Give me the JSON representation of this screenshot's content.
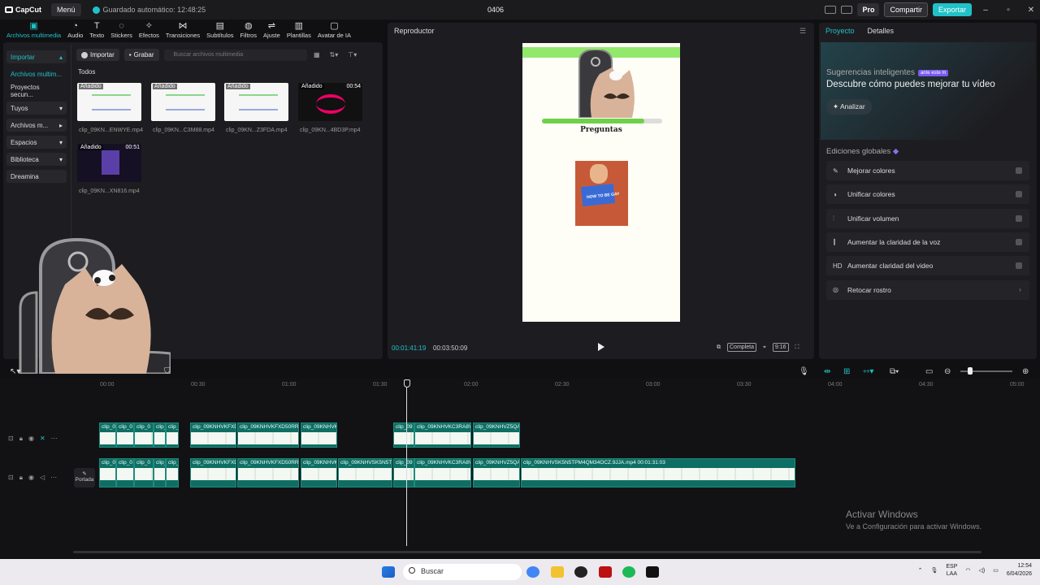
{
  "app": {
    "name": "CapCut",
    "menu_label": "Menú",
    "autosave": "Guardado automático: 12:48:25",
    "project_title": "0406"
  },
  "titlebar": {
    "pro_label": "Pro",
    "share_label": "Compartir",
    "export_label": "Exportar"
  },
  "tools": [
    {
      "label": "Archivos multimedia",
      "icon": "media-icon",
      "glyph": "▣"
    },
    {
      "label": "Audio",
      "icon": "audio-icon",
      "glyph": "◔"
    },
    {
      "label": "Texto",
      "icon": "text-icon",
      "glyph": "T"
    },
    {
      "label": "Stickers",
      "icon": "sticker-icon",
      "glyph": "◌"
    },
    {
      "label": "Efectos",
      "icon": "effects-icon",
      "glyph": "✧"
    },
    {
      "label": "Transiciones",
      "icon": "transitions-icon",
      "glyph": "⋈"
    },
    {
      "label": "Subtítulos",
      "icon": "subtitles-icon",
      "glyph": "▤"
    },
    {
      "label": "Filtros",
      "icon": "filters-icon",
      "glyph": "◍"
    },
    {
      "label": "Ajuste",
      "icon": "adjust-icon",
      "glyph": "⇌"
    },
    {
      "label": "Plantillas",
      "icon": "templates-icon",
      "glyph": "▥"
    },
    {
      "label": "Avatar de IA",
      "icon": "avatar-icon",
      "glyph": "▢"
    }
  ],
  "sidebar": [
    {
      "label": "Importar",
      "arrow": "▴"
    },
    {
      "label": "Archivos multim...",
      "arrow": ""
    },
    {
      "label": "Proyectos secun...",
      "arrow": ""
    },
    {
      "label": "Tuyos",
      "arrow": "▾"
    },
    {
      "label": "Archivos m...",
      "arrow": "▸"
    },
    {
      "label": "Espacios",
      "arrow": "▾"
    },
    {
      "label": "Biblioteca",
      "arrow": "▾"
    },
    {
      "label": "Dreamina",
      "arrow": ""
    }
  ],
  "media": {
    "import_label": "Importar",
    "record_label": "Grabar",
    "search_placeholder": "Buscar archivos multimedia",
    "section_label": "Todos",
    "items": [
      {
        "tag": "Añadido",
        "duration": "",
        "name": "clip_09KN...ENWYE.mp4"
      },
      {
        "tag": "Añadido",
        "duration": "",
        "name": "clip_09KN...C3M88.mp4"
      },
      {
        "tag": "Añadido",
        "duration": "",
        "name": "clip_09KN...Z3FDA.mp4"
      },
      {
        "tag": "Añadido",
        "duration": "00:54",
        "name": "clip_09KN...4BD3P.mp4"
      },
      {
        "tag": "Añadido",
        "duration": "00:51",
        "name": "clip_09KN...XN816.mp4"
      }
    ]
  },
  "player": {
    "title": "Reproductor",
    "canvas_heading": "Preguntas",
    "book_text": "HOW TO BE GAY",
    "current_time": "00:01:41:19",
    "total_time": "00:03:50:09",
    "complete_label": "Completa",
    "ratio_label": "9:16"
  },
  "right": {
    "tab_project": "Proyecto",
    "tab_details": "Detalles",
    "sugg_title": "Sugerencias inteligentes",
    "sugg_badge": "ante este m",
    "sugg_sub": "Descubre cómo puedes mejorar tu vídeo",
    "analyze_label": "Analizar",
    "global_title": "Ediciones globales",
    "options": [
      {
        "label": "Mejorar colores",
        "icon": "color-wand-icon",
        "glyph": "✎"
      },
      {
        "label": "Unificar colores",
        "icon": "color-unify-icon",
        "glyph": "◑"
      },
      {
        "label": "Unificar volumen",
        "icon": "volume-icon",
        "glyph": "⫶"
      },
      {
        "label": "Aumentar la claridad de la voz",
        "icon": "voice-icon",
        "glyph": "∥"
      },
      {
        "label": "Aumentar claridad del video",
        "icon": "hd-icon",
        "glyph": "HD"
      },
      {
        "label": "Retocar rostro",
        "icon": "face-icon",
        "glyph": "◎"
      }
    ]
  },
  "timeline": {
    "ruler": [
      "00:00",
      "00:30",
      "01:00",
      "01:30",
      "02:00",
      "02:30",
      "03:00",
      "03:30",
      "04:00",
      "04:30",
      "05:00"
    ],
    "cover_label": "Portada",
    "overlay_clips": [
      "clip_0",
      "clip_0",
      "clip_0",
      "clip_0",
      "clip_0",
      "clip_09KNHVKFXD",
      "clip_09KNHVKFXD50RR",
      "clip_09KNHVK",
      "clip_09",
      "clip_09KNHVKC3RA8V",
      "clip_09KNHVZ5QA"
    ],
    "main_clips": [
      "clip_0",
      "clip_0",
      "clip_0",
      "clip_0",
      "clip_0",
      "clip_09KNHVKFXD",
      "clip_09KNHVKFXD50RR",
      "clip_09KNHVK",
      "clip_09KNHVSK5N5T",
      "clip_09",
      "clip_09KNHVKC3RA8V",
      "clip_09KNHVZ5QA",
      "clip_09KNHVSK5N5TPM4QM34OCZ.9JJA.mp4  00:01:31:03"
    ]
  },
  "watermark": {
    "line1": "Activar Windows",
    "line2": "Ve a Configuración para activar Windows."
  },
  "taskbar": {
    "search_label": "Buscar",
    "lang1": "ESP",
    "lang2": "LAA",
    "time": "12:54",
    "date": "6/04/2026"
  }
}
